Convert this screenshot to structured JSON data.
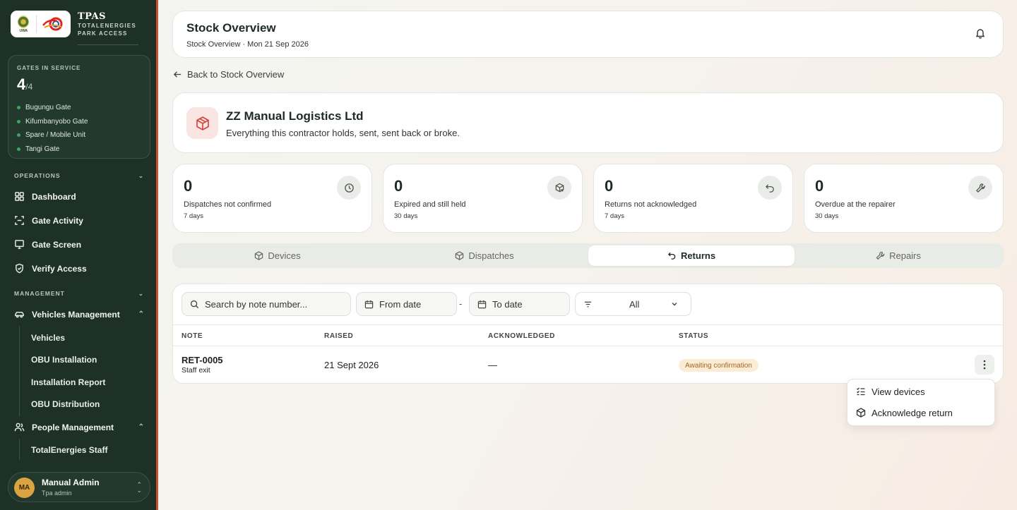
{
  "brand": {
    "uwa_text": "UWA",
    "title": "TPAS",
    "sub1": "TOTALENERGIES",
    "sub2": "PARK ACCESS"
  },
  "gates": {
    "label": "GATES IN SERVICE",
    "count": "4",
    "total": "/4",
    "items": [
      "Bugungu Gate",
      "Kifumbanyobo Gate",
      "Spare / Mobile Unit",
      "Tangi Gate"
    ]
  },
  "sidebar": {
    "operations_label": "OPERATIONS",
    "operations": [
      "Dashboard",
      "Gate Activity",
      "Gate Screen",
      "Verify Access"
    ],
    "management_label": "MANAGEMENT",
    "vehicles_label": "Vehicles Management",
    "vehicles_sub": [
      "Vehicles",
      "OBU Installation",
      "Installation Report",
      "OBU Distribution"
    ],
    "people_label": "People Management",
    "people_sub": [
      "TotalEnergies Staff"
    ]
  },
  "user": {
    "initials": "MA",
    "name": "Manual Admin",
    "role": "Tpa admin"
  },
  "header": {
    "title": "Stock Overview",
    "subtitle": "Stock Overview · Mon 21 Sep 2026"
  },
  "back_label": "Back to Stock Overview",
  "contractor": {
    "name": "ZZ Manual Logistics Ltd",
    "description": "Everything this contractor holds, sent, sent back or broke."
  },
  "stats": [
    {
      "value": "0",
      "label": "Dispatches not confirmed",
      "sub": "7 days"
    },
    {
      "value": "0",
      "label": "Expired and still held",
      "sub": "30 days"
    },
    {
      "value": "0",
      "label": "Returns not acknowledged",
      "sub": "7 days"
    },
    {
      "value": "0",
      "label": "Overdue at the repairer",
      "sub": "30 days"
    }
  ],
  "tabs": [
    "Devices",
    "Dispatches",
    "Returns",
    "Repairs"
  ],
  "active_tab": "Returns",
  "filters": {
    "search_placeholder": "Search by note number...",
    "from_date": "From date",
    "separator": "-",
    "to_date": "To date",
    "status": "All"
  },
  "table": {
    "columns": [
      "NOTE",
      "RAISED",
      "ACKNOWLEDGED",
      "STATUS"
    ],
    "rows": [
      {
        "note": "RET-0005",
        "note_sub": "Staff exit",
        "raised": "21 Sept 2026",
        "acknowledged": "—",
        "status": "Awaiting confirmation"
      }
    ]
  },
  "row_menu": [
    "View devices",
    "Acknowledge return"
  ],
  "colors": {
    "sidebar": "#1d3127",
    "accent": "#c6532e",
    "status_bg": "#fbecd6",
    "status_text": "#a5661a"
  }
}
